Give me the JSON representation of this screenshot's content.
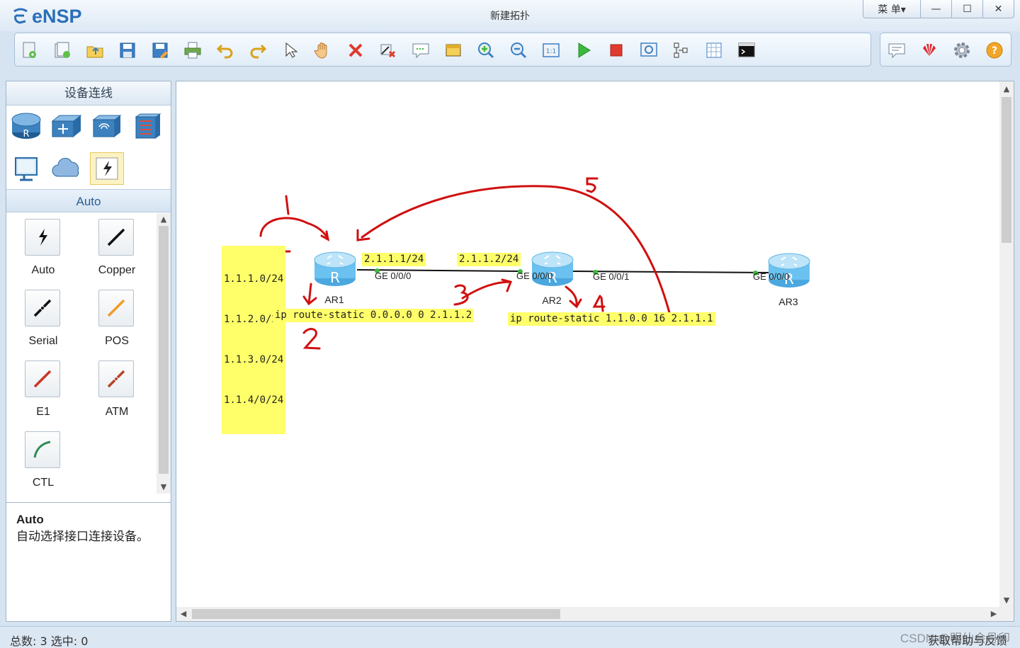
{
  "app": {
    "name": "eNSP",
    "window_title": "新建拓扑",
    "menu_label": "菜 单▾",
    "min_glyph": "—",
    "max_glyph": "☐",
    "close_glyph": "✕"
  },
  "toolbar": {
    "icons": [
      "new-topology-icon",
      "new-example-icon",
      "open-icon",
      "save-icon",
      "save-as-icon",
      "print-icon",
      "undo-icon",
      "redo-icon",
      "select-icon",
      "pan-hand-icon",
      "delete-icon",
      "delete-link-icon",
      "text-note-icon",
      "palette-icon",
      "zoom-in-icon",
      "zoom-out-icon",
      "fit-icon",
      "start-all-icon",
      "stop-all-icon",
      "capture-icon",
      "topology-icon",
      "grid-icon",
      "terminal-icon"
    ],
    "right_icons": [
      "chat-icon",
      "huawei-icon",
      "settings-icon",
      "help-icon"
    ]
  },
  "left_panel": {
    "title": "设备连线",
    "device_categories": [
      "router-icon",
      "switch-icon",
      "wireless-icon",
      "firewall-icon",
      "pc-icon",
      "cloud-icon",
      "connection-icon"
    ],
    "section_title": "Auto",
    "cables": [
      {
        "label": "Auto",
        "icon": "auto-cable-icon",
        "color": "#111111"
      },
      {
        "label": "Copper",
        "icon": "copper-cable-icon",
        "color": "#111111"
      },
      {
        "label": "Serial",
        "icon": "serial-cable-icon",
        "color": "#111111"
      },
      {
        "label": "POS",
        "icon": "pos-cable-icon",
        "color": "#f39b27"
      },
      {
        "label": "E1",
        "icon": "e1-cable-icon",
        "color": "#c9362a"
      },
      {
        "label": "ATM",
        "icon": "atm-cable-icon",
        "color": "#b8442a"
      },
      {
        "label": "CTL",
        "icon": "ctl-cable-icon",
        "color": "#2e8b57"
      }
    ],
    "description": {
      "title": "Auto",
      "text": "自动选择接口连接设备。"
    }
  },
  "topology": {
    "devices": [
      {
        "name": "AR1"
      },
      {
        "name": "AR2"
      },
      {
        "name": "AR3"
      }
    ],
    "interfaces": {
      "ar1_ge000": "GE 0/0/0",
      "ar2_ge000": "GE 0/0/0",
      "ar2_ge001": "GE 0/0/1",
      "ar3_ge000": "GE 0/0/0"
    },
    "notes": {
      "loopbacks": [
        "1.1.1.0/24",
        "1.1.2.0/24",
        "1.1.3.0/24",
        "1.1.4/0/24"
      ],
      "ar1_ip": "2.1.1.1/24",
      "ar2_ip": "2.1.1.2/24",
      "ar1_route": "ip route-static 0.0.0.0 0 2.1.1.2",
      "ar2_route": "ip route-static 1.1.0.0 16 2.1.1.1"
    },
    "annotations": [
      "1",
      "2",
      "3",
      "4",
      "5"
    ],
    "annotation_color": "#d01010"
  },
  "status": {
    "text": "总数: 3  选中: 0",
    "feedback": "获取帮助与反馈",
    "watermark": "CSDN @明仙会丹印"
  }
}
